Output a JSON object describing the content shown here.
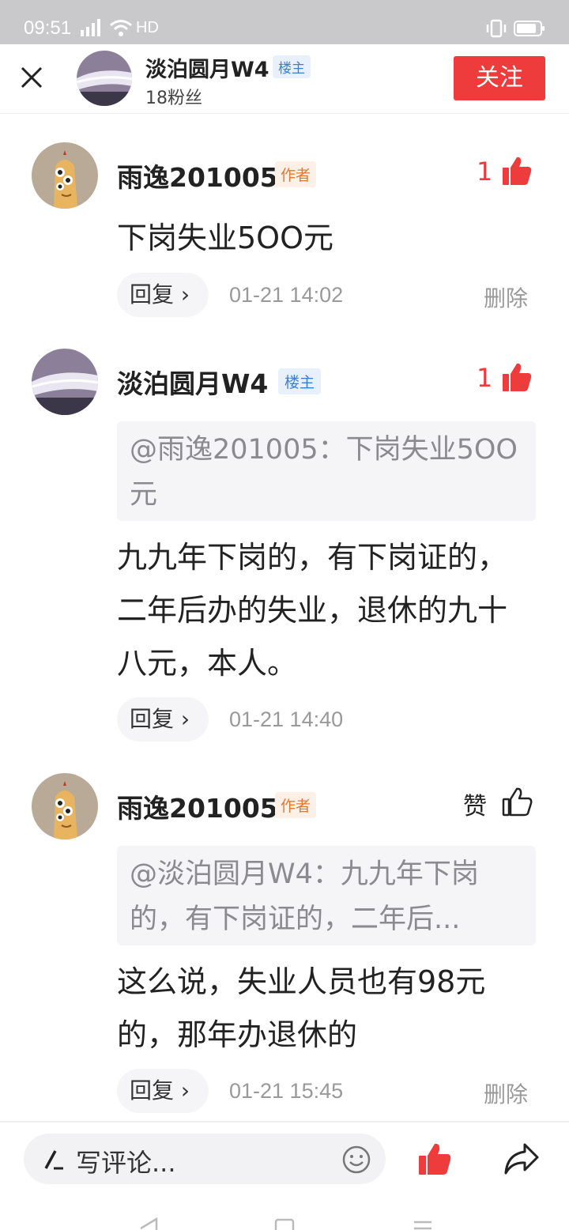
{
  "status_bar": {
    "time": "09:51",
    "network": "HD",
    "icons": [
      "signal-icon",
      "wifi-icon",
      "vibrate-icon",
      "battery-icon"
    ]
  },
  "header": {
    "username": "淡泊圆月W4",
    "owner_badge": "楼主",
    "followers": "18粉丝",
    "follow_label": "关注",
    "close_icon": "close-icon"
  },
  "comments": [
    {
      "author": "雨逸201005",
      "badge": "作者",
      "like_count": "1",
      "liked": true,
      "text": "下岗失业5OO元",
      "reply_label": "回复",
      "time": "01-21 14:02",
      "delete_label": "删除"
    },
    {
      "author": "淡泊圆月W4",
      "badge": "楼主",
      "like_count": "1",
      "liked": true,
      "quote": "@雨逸201005：下岗失业5OO元",
      "text": "九九年下岗的，有下岗证的，二年后办的失业，退休的九十八元，本人。",
      "reply_label": "回复",
      "time": "01-21 14:40"
    },
    {
      "author": "雨逸201005",
      "badge": "作者",
      "like_label": "赞",
      "liked": false,
      "quote": "@淡泊圆月W4：九九年下岗的，有下岗证的，二年后...",
      "text": "这么说，失业人员也有98元的，那年办退休的",
      "reply_label": "回复",
      "time": "01-21 15:45",
      "delete_label": "删除"
    }
  ],
  "bottom_bar": {
    "input_placeholder": "写评论...",
    "icons": [
      "pen-icon",
      "emoji-icon",
      "thumbs-up-icon",
      "share-icon"
    ]
  },
  "colors": {
    "accent_red": "#ee3b3b",
    "owner_blue": "#3d7fd6",
    "author_orange": "#e5782f",
    "status_bar_gray": "#c9c9cb"
  }
}
